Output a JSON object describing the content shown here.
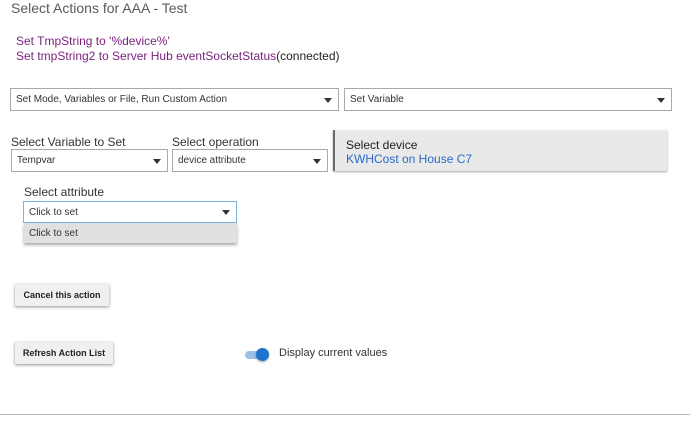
{
  "dialog": {
    "title": "Select Actions for AAA - Test"
  },
  "actions": [
    {
      "text": "Set TmpString to '%device%'",
      "suffix": ""
    },
    {
      "text": "Set tmpString2 to Server Hub eventSocketStatus",
      "suffix": "(connected)"
    }
  ],
  "action_type": {
    "category_value": "Set Mode, Variables or File, Run Custom Action",
    "action_value": "Set Variable"
  },
  "variable_section": {
    "variable_label": "Select Variable to Set",
    "variable_value": "Tempvar",
    "operation_label": "Select operation",
    "operation_value": "device attribute"
  },
  "device": {
    "label": "Select device",
    "value": "KWHCost on House C7"
  },
  "attribute": {
    "label": "Select attribute",
    "value": "Click to set",
    "options": [
      "Click to set"
    ]
  },
  "buttons": {
    "cancel_label": "Cancel this action",
    "refresh_label": "Refresh Action List"
  },
  "display_toggle": {
    "label": "Display current values",
    "on": true
  },
  "colors": {
    "action_text": "#7a1f7e",
    "link_blue": "#2a6ac8",
    "toggle_blue": "#1e74cf",
    "focus_border": "#7cb1e8"
  }
}
